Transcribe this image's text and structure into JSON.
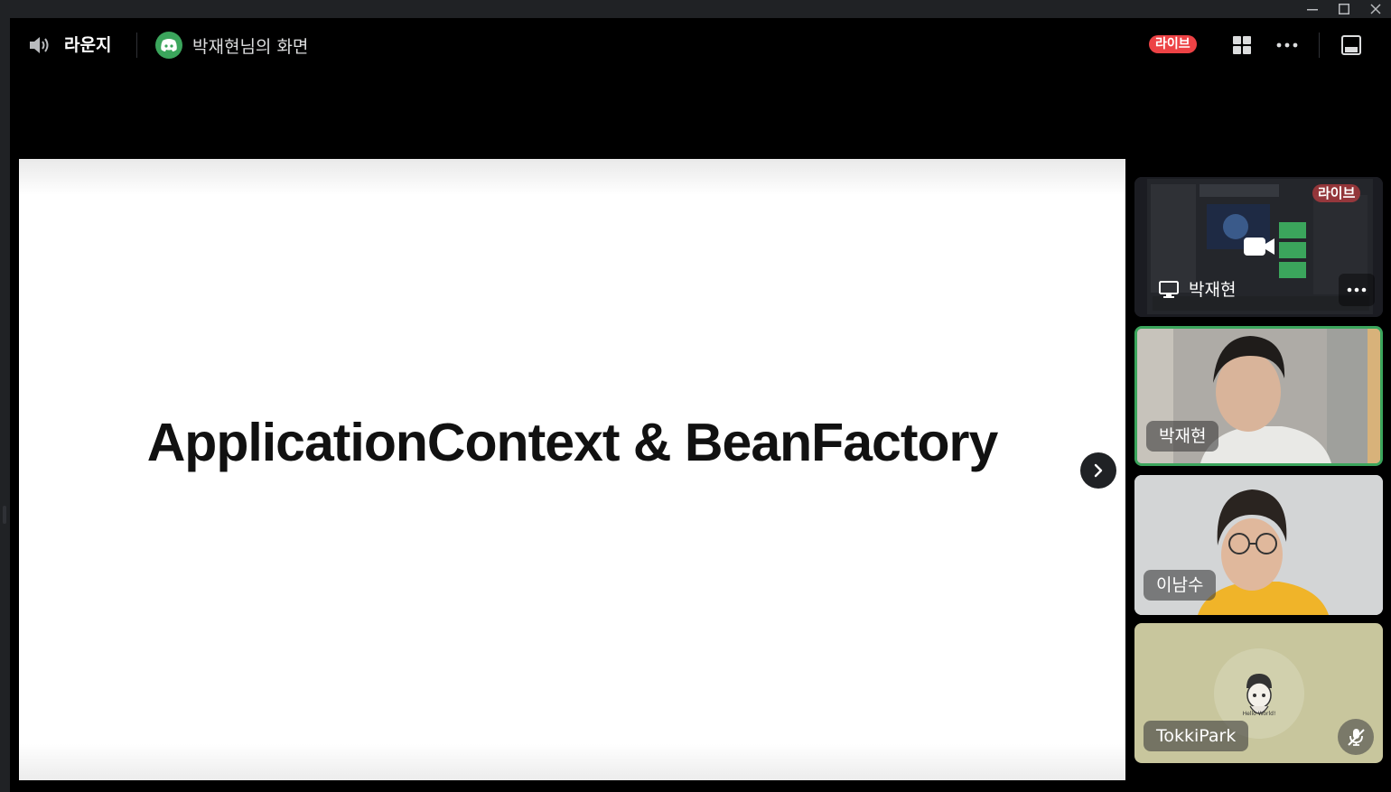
{
  "window": {
    "minimize_icon": "minimize-icon",
    "maximize_icon": "maximize-icon",
    "close_icon": "close-icon"
  },
  "header": {
    "channel_name": "라운지",
    "channel_icon": "speaker-icon",
    "stream_title": "박재현님의 화면",
    "live_label": "라이브",
    "live_color": "#ed4245",
    "grid_icon": "grid-icon",
    "more_icon": "more-icon",
    "popout_icon": "popout-icon"
  },
  "stage": {
    "slide_title": "ApplicationContext & BeanFactory",
    "next_icon": "chevron-right-icon"
  },
  "participants": [
    {
      "name": "박재현",
      "type": "screen-share",
      "live_label": "라이브",
      "icon": "monitor-icon"
    },
    {
      "name": "박재현",
      "type": "camera",
      "speaking": true
    },
    {
      "name": "이남수",
      "type": "camera"
    },
    {
      "name": "TokkiPark",
      "type": "avatar",
      "muted": true,
      "avatar_caption": "Hello World!"
    }
  ],
  "colors": {
    "speaking_ring": "#3ba55c",
    "discord_green": "#3ba55c"
  }
}
